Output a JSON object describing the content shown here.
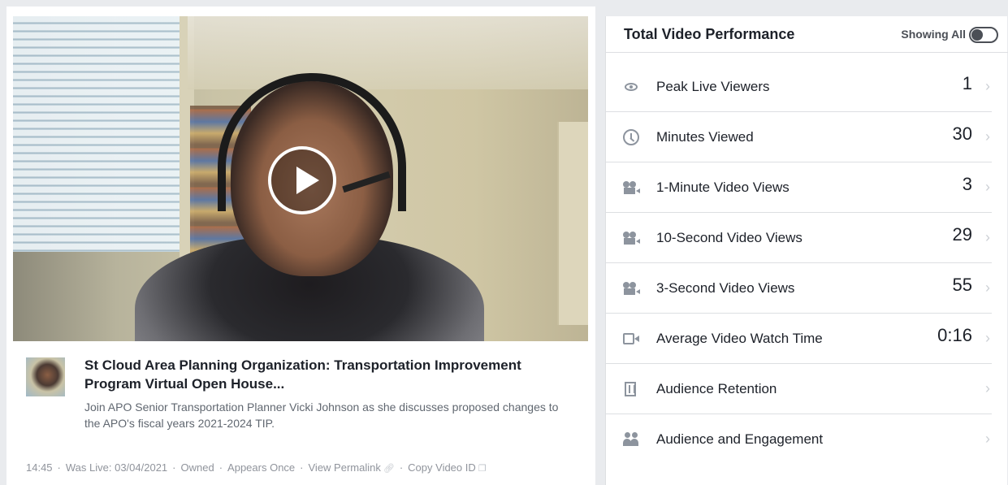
{
  "video": {
    "title": "St Cloud Area Planning Organization: Transportation Improvement Program Virtual Open House...",
    "description": "Join APO Senior Transportation Planner Vicki Johnson as she discusses proposed changes to the APO's fiscal years 2021-2024 TIP.",
    "duration": "14:45",
    "was_live": "Was Live: 03/04/2021",
    "ownership": "Owned",
    "appears": "Appears Once",
    "view_permalink": "View Permalink",
    "copy_video_id": "Copy Video ID"
  },
  "performance": {
    "title": "Total Video Performance",
    "showing_label": "Showing All",
    "metrics": [
      {
        "label": "Peak Live Viewers",
        "value": "1",
        "icon": "eye-icon"
      },
      {
        "label": "Minutes Viewed",
        "value": "30",
        "icon": "clock-icon"
      },
      {
        "label": "1-Minute Video Views",
        "value": "3",
        "icon": "video-camera-icon"
      },
      {
        "label": "10-Second Video Views",
        "value": "29",
        "icon": "video-camera-icon"
      },
      {
        "label": "3-Second Video Views",
        "value": "55",
        "icon": "video-camera-icon"
      },
      {
        "label": "Average Video Watch Time",
        "value": "0:16",
        "icon": "video-icon"
      },
      {
        "label": "Audience Retention",
        "value": "",
        "icon": "film-icon"
      },
      {
        "label": "Audience and Engagement",
        "value": "",
        "icon": "people-icon"
      }
    ]
  },
  "colors": {
    "text": "#1d2129",
    "muted": "#606770",
    "meta": "#90949c",
    "icon": "#8d949e",
    "divider": "#dddfe2",
    "background": "#e9ebee"
  }
}
